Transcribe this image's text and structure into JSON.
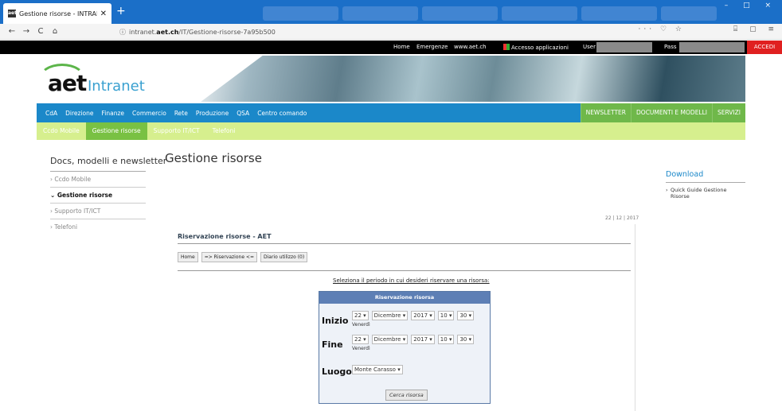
{
  "browser": {
    "tab_title": "Gestione risorse - INTRANET -",
    "tab_favicon": "aet",
    "new_tab": "+",
    "url_prefix": "intranet.",
    "url_domain": "aet.ch",
    "url_path": "/IT/Gestione-risorse-7a95b500",
    "url_more": "···",
    "nav_back": "←",
    "nav_forward": "→",
    "nav_reload": "C",
    "nav_home": "⌂",
    "window_controls": "– □ ×",
    "right_tools": "⌸ ▢ ≡"
  },
  "topbar": {
    "links": [
      "Home",
      "Emergenze",
      "www.aet.ch"
    ],
    "apps": "Accesso applicazioni",
    "user_label": "User",
    "pass_label": "Pass",
    "login_button": "ACCEDI"
  },
  "logo": {
    "brand": "aet",
    "product": "Intranet"
  },
  "menu1": {
    "items": [
      "CdA",
      "Direzione",
      "Finanze",
      "Commercio",
      "Rete",
      "Produzione",
      "QSA",
      "Centro comando"
    ],
    "right_items": [
      "NEWSLETTER",
      "DOCUMENTI E MODELLI",
      "SERVIZI"
    ]
  },
  "menu2": {
    "items": [
      "Ccdo Mobile",
      "Gestione risorse",
      "Supporto IT/ICT",
      "Telefoni"
    ]
  },
  "sidebar": {
    "heading": "Docs, modelli e newsletter",
    "items": [
      "› Ccdo Mobile",
      "⌄ Gestione risorse",
      "› Supporto IT/ICT",
      "› Telefoni"
    ]
  },
  "page": {
    "title": "Gestione risorse",
    "date": "22 | 12 | 2017"
  },
  "download": {
    "heading": "Download",
    "link": "Quick Guide Gestione Risorse"
  },
  "reservation": {
    "title": "Riservazione risorse - AET",
    "buttons": [
      "Home",
      "=> Riservazione <=",
      "Diario utilizzo (0)"
    ],
    "instruction": "Seleziona il periodo in cui desideri riservare una risorsa:",
    "form_title": "Riservazione risorsa",
    "start_label": "Inizio",
    "end_label": "Fine",
    "place_label": "Luogo",
    "start": {
      "day": "22",
      "month": "Dicembre",
      "year": "2017",
      "hour": "10",
      "minute": "30",
      "weekday": "Venerdì"
    },
    "end": {
      "day": "22",
      "month": "Dicembre",
      "year": "2017",
      "hour": "10",
      "minute": "30",
      "weekday": "Venerdì"
    },
    "place": "Monte Carasso",
    "search_button": "Cerca risorsa"
  }
}
